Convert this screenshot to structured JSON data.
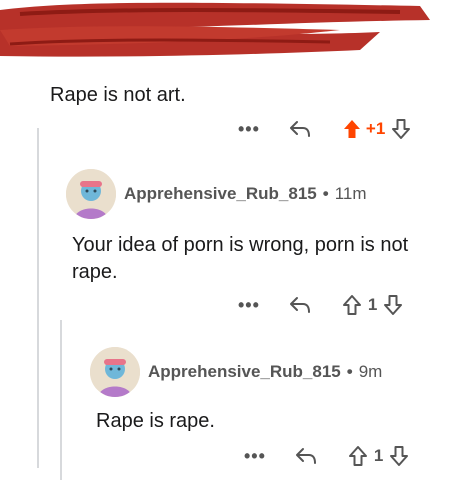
{
  "comments": [
    {
      "text": "Rape is not art.",
      "actions": {
        "more": "•••",
        "score": "+1",
        "upvoted": true
      }
    },
    {
      "username": "Apprehensive_Rub_815",
      "separator": "•",
      "time": "11m",
      "text": "Your idea of porn is wrong, porn is not rape.",
      "actions": {
        "more": "•••",
        "score": "1",
        "upvoted": false
      }
    },
    {
      "username": "Apprehensive_Rub_815",
      "separator": "•",
      "time": "9m",
      "text": "Rape is rape.",
      "actions": {
        "more": "•••",
        "score": "1",
        "upvoted": false
      }
    }
  ],
  "colors": {
    "upvote_active": "#ff4500",
    "redaction": "#b3261e",
    "thread_line": "#d7d9dc"
  },
  "icons": [
    "reply-icon",
    "upvote-icon",
    "downvote-icon",
    "more-options-icon",
    "avatar"
  ]
}
